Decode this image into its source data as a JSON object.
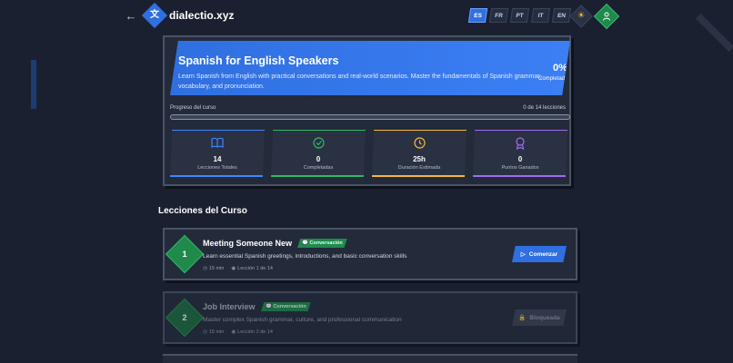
{
  "header": {
    "back_glyph": "←",
    "logo_glyph": "文",
    "brand": "dialectio.xyz",
    "languages": [
      "ES",
      "FR",
      "PT",
      "IT",
      "EN"
    ],
    "active_language": "ES",
    "theme_glyph": "☀",
    "user_glyph": "👤"
  },
  "course": {
    "title": "Spanish for English Speakers",
    "description": "Learn Spanish from English with practical conversations and real-world scenarios. Master the fundamentals of Spanish grammar, vocabulary, and pronunciation.",
    "percent": "0%",
    "percent_label": "Completado",
    "progress_label": "Progreso del curso",
    "progress_count": "0 de 14 lecciones",
    "progress_fraction": 0
  },
  "stats": [
    {
      "icon": "book-icon",
      "glyph": "📖",
      "value": "14",
      "label": "Lecciones Totales",
      "color": "#3f86ff"
    },
    {
      "icon": "check-circle-icon",
      "glyph": "✓",
      "value": "0",
      "label": "Completadas",
      "color": "#2fb865"
    },
    {
      "icon": "clock-icon",
      "glyph": "◷",
      "value": "25h",
      "label": "Duración Estimada",
      "color": "#f5b73b"
    },
    {
      "icon": "award-icon",
      "glyph": "✪",
      "value": "0",
      "label": "Puntos Ganados",
      "color": "#a06cf0"
    }
  ],
  "section": {
    "title": "Lecciones del Curso"
  },
  "lessons": [
    {
      "number": "1",
      "title": "Meeting Someone New",
      "tag": "Conversación",
      "description": "Learn essential Spanish greetings, introductions, and basic conversation skills",
      "duration": "15 min",
      "position": "Lección 1 de 14",
      "action": "Comenzar",
      "locked": false
    },
    {
      "number": "2",
      "title": "Job Interview",
      "tag": "Conversación",
      "description": "Master complex Spanish grammar, culture, and professional communication",
      "duration": "15 min",
      "position": "Lección 2 de 14",
      "action": "Bloqueada",
      "locked": true
    }
  ],
  "colors": {
    "accent": "#2f6fe0",
    "success": "#1f8a4c",
    "background": "#1a2030"
  }
}
